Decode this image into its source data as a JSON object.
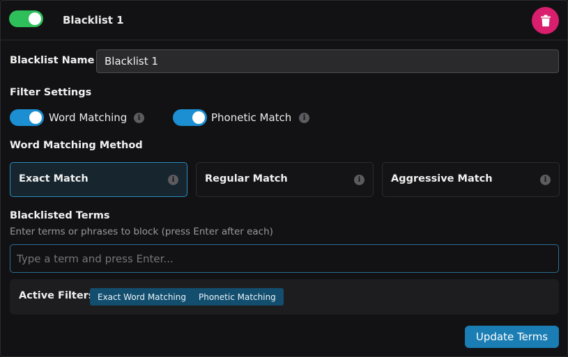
{
  "header": {
    "enabled": true,
    "title": "Blacklist 1",
    "delete_icon": "trash-icon"
  },
  "name_field": {
    "label": "Blacklist Name",
    "value": "Blacklist 1"
  },
  "filter_settings": {
    "heading": "Filter Settings",
    "options": [
      {
        "label": "Word Matching",
        "enabled": true,
        "icon": "info-icon"
      },
      {
        "label": "Phonetic Match",
        "enabled": true,
        "icon": "info-icon"
      }
    ]
  },
  "matching_method": {
    "heading": "Word Matching Method",
    "selected": "Exact Match",
    "options": [
      {
        "label": "Exact Match"
      },
      {
        "label": "Regular Match"
      },
      {
        "label": "Aggressive Match"
      }
    ]
  },
  "terms": {
    "heading": "Blacklisted Terms",
    "hint": "Enter terms or phrases to block (press Enter after each)",
    "placeholder": "Type a term and press Enter..."
  },
  "active_filters": {
    "label": "Active Filters:",
    "chips": [
      "Exact Word Matching",
      "Phonetic Matching"
    ]
  },
  "update_button": "Update Terms",
  "colors": {
    "toggle_green": "#2ebf5a",
    "toggle_blue": "#1b8fd1",
    "delete_pink": "#d81e6c",
    "accent_blue": "#1a7db3",
    "chip_bg": "#134e6e"
  }
}
